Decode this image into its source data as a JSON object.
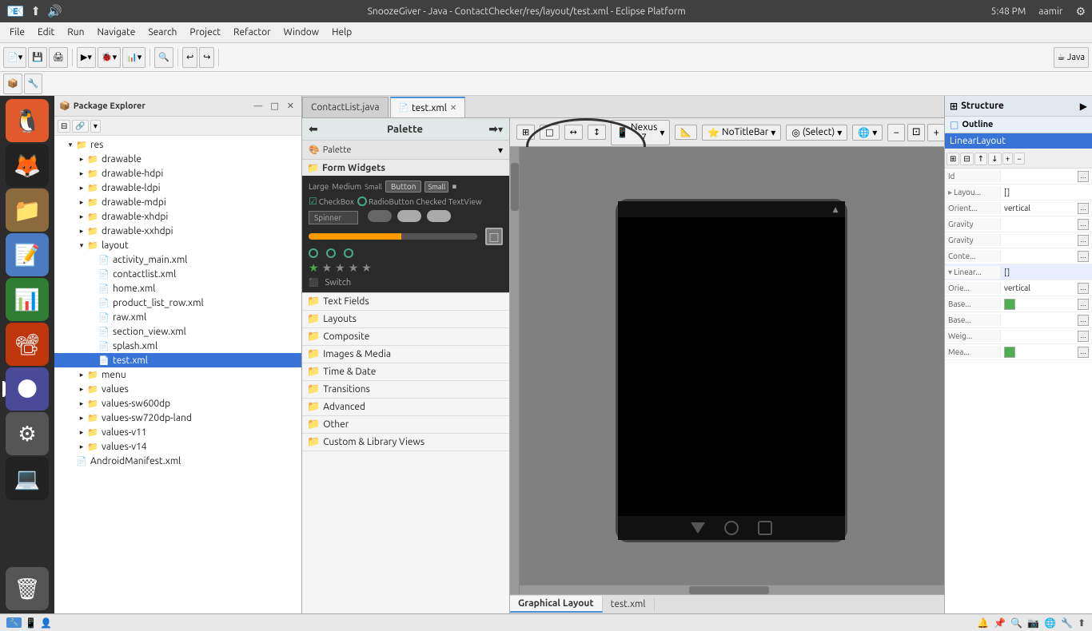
{
  "titlebar": {
    "title": "SnoozeGiver - Java - ContactChecker/res/layout/test.xml - Eclipse Platform",
    "time": "5:48 PM",
    "user": "aamir"
  },
  "menubar": {
    "items": [
      "File",
      "Edit",
      "Run",
      "Navigate",
      "Search",
      "Project",
      "Refactor",
      "Window",
      "Help"
    ]
  },
  "tabs": {
    "open": [
      {
        "label": "ContactList.java",
        "active": false
      },
      {
        "label": "test.xml",
        "active": true
      }
    ]
  },
  "package_explorer": {
    "title": "Package Explorer",
    "tree": {
      "res": {
        "label": "res",
        "children": {
          "drawable": "drawable",
          "drawable-hdpi": "drawable-hdpi",
          "drawable-ldpi": "drawable-ldpi",
          "drawable-mdpi": "drawable-mdpi",
          "drawable-xhdpi": "drawable-xhdpi",
          "drawable-xxhdpi": "drawable-xxhdpi",
          "layout": {
            "label": "layout",
            "children": [
              "activity_main.xml",
              "contactlist.xml",
              "home.xml",
              "product_list_row.xml",
              "raw.xml",
              "section_view.xml",
              "splash.xml",
              "test.xml"
            ]
          },
          "menu": "menu",
          "values": "values",
          "values-sw600dp": "values-sw600dp",
          "values-sw720dp-land": "values-sw720dp-land",
          "values-v11": "values-v11",
          "values-v14": "values-v14"
        }
      },
      "androidmanifest": "AndroidManifest.xml"
    }
  },
  "palette": {
    "title": "Palette",
    "sections": {
      "form_widgets": "Form Widgets",
      "text_fields": "Text Fields",
      "layouts": "Layouts",
      "composite": "Composite",
      "images_media": "Images & Media",
      "time_date": "Time & Date",
      "transitions": "Transitions",
      "advanced": "Advanced",
      "other": "Other",
      "custom_library": "Custom & Library Views"
    }
  },
  "canvas": {
    "device": "Nexus 7",
    "theme": "NoTitleBar",
    "activity": "(Select)",
    "globe_icon": "🌐"
  },
  "structure": {
    "title": "Structure",
    "outline_label": "Outline",
    "item": "LinearLayout"
  },
  "properties": {
    "rows": [
      {
        "label": "Id",
        "value": "",
        "expand": false
      },
      {
        "label": "Layou...",
        "value": "[]",
        "expand": true
      },
      {
        "label": "Orient...",
        "value": "vertical",
        "expand": false
      },
      {
        "label": "Gravity",
        "value": "",
        "expand": false
      },
      {
        "label": "Gravity",
        "value": "",
        "expand": false
      },
      {
        "label": "Conte...",
        "value": "",
        "expand": false
      },
      {
        "label": "Linear...",
        "value": "[]",
        "expand": true
      },
      {
        "label": "Orie...",
        "value": "vertical",
        "expand": false
      },
      {
        "label": "Base...",
        "value": "",
        "expand": false,
        "color": "#4CAF50"
      },
      {
        "label": "Base...",
        "value": "",
        "expand": false
      },
      {
        "label": "Weig...",
        "value": "",
        "expand": false
      },
      {
        "label": "Mea...",
        "value": "",
        "expand": false,
        "color": "#4CAF50"
      }
    ]
  },
  "bottom_tabs": {
    "graphical_layout": "Graphical Layout",
    "test_xml": "test.xml"
  },
  "status_bar": {
    "text": ""
  }
}
